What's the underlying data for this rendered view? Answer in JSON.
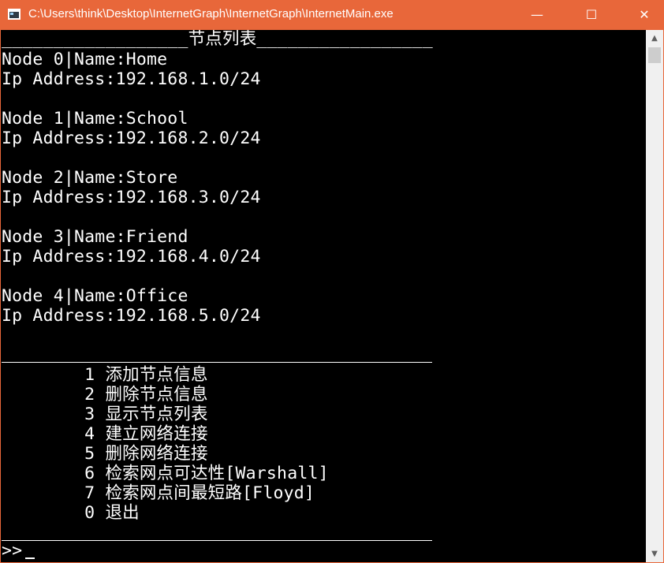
{
  "window": {
    "title": "C:\\Users\\think\\Desktop\\InternetGraph\\InternetGraph\\InternetMain.exe",
    "minimize": "—",
    "maximize": "☐",
    "close": "✕"
  },
  "console": {
    "header": "__________________节点列表_________________",
    "nodes": [
      {
        "title": "Node 0|Name:Home",
        "ip": "Ip Address:192.168.1.0/24"
      },
      {
        "title": "Node 1|Name:School",
        "ip": "Ip Address:192.168.2.0/24"
      },
      {
        "title": "Node 2|Name:Store",
        "ip": "Ip Address:192.168.3.0/24"
      },
      {
        "title": "Node 3|Name:Friend",
        "ip": "Ip Address:192.168.4.0/24"
      },
      {
        "title": "Node 4|Name:Office",
        "ip": "Ip Address:192.168.5.0/24"
      }
    ],
    "menu": [
      "        1 添加节点信息",
      "        2 删除节点信息",
      "        3 显示节点列表",
      "        4 建立网络连接",
      "        5 删除网络连接",
      "        6 检索网点可达性[Warshall]",
      "        7 检索网点间最短路[Floyd]",
      "        0 退出"
    ],
    "prompt": ">>"
  },
  "scrollbar": {
    "up": "▲",
    "down": "▼"
  }
}
